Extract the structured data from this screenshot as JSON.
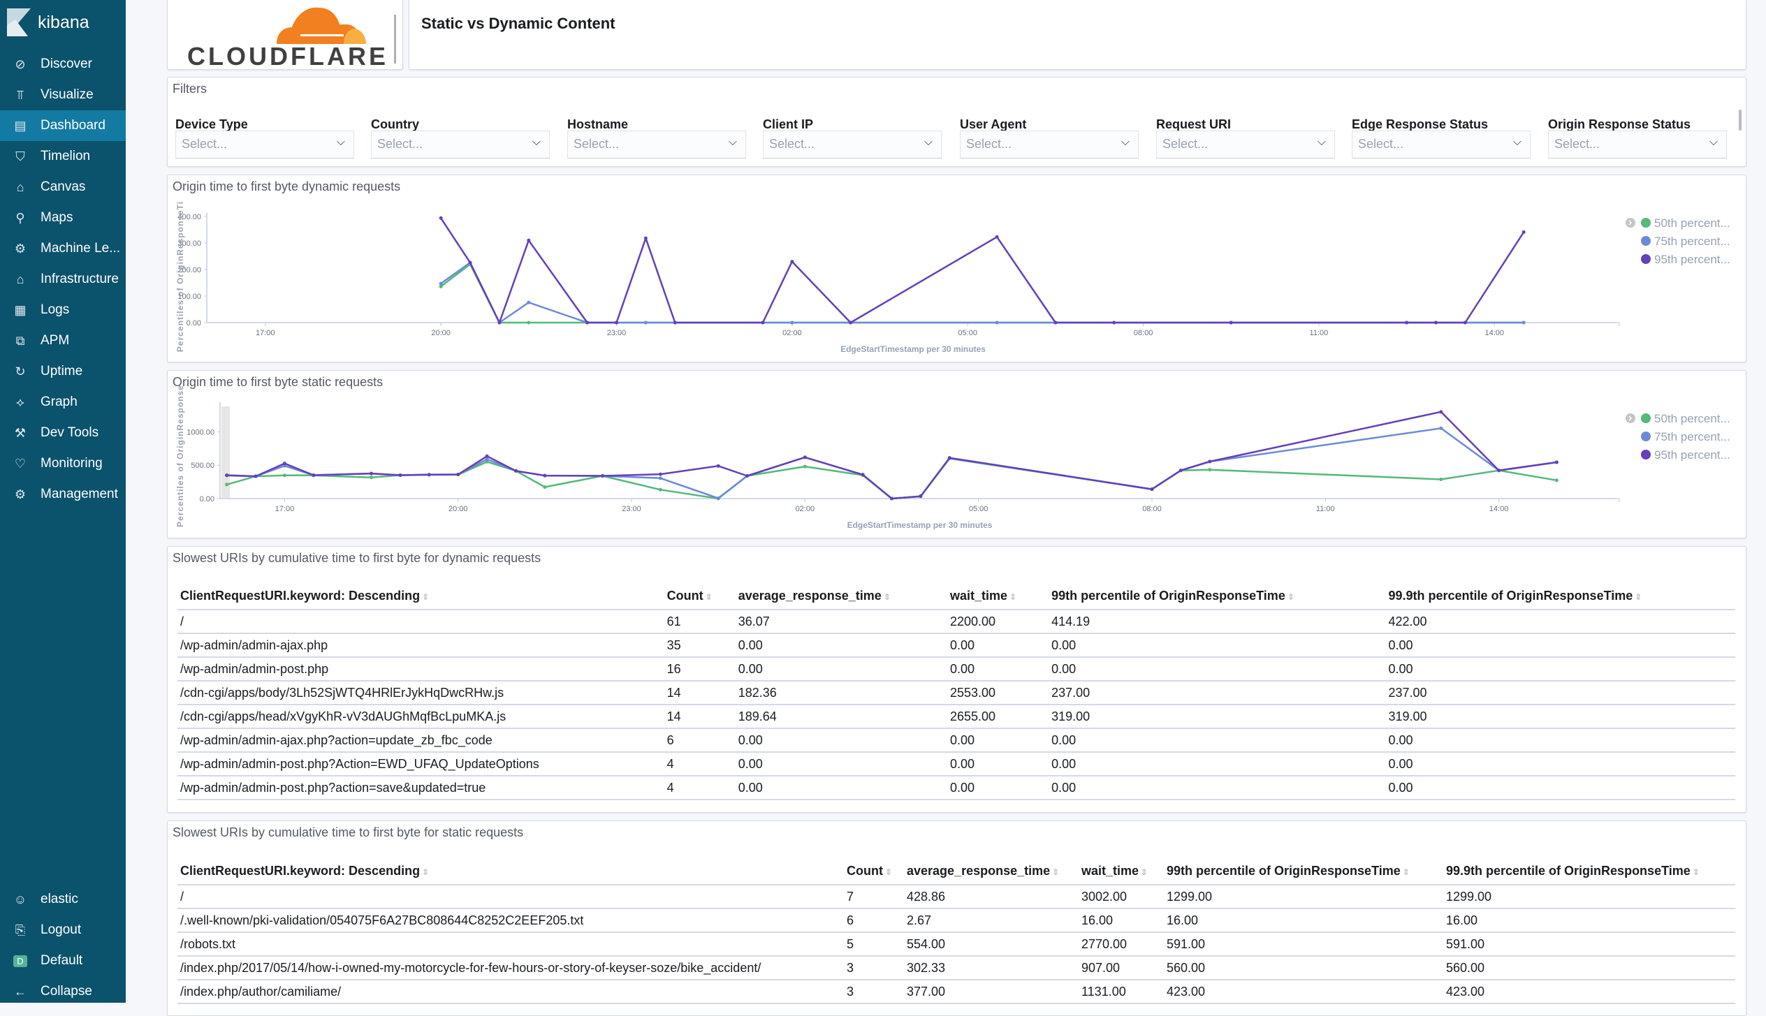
{
  "sidebar": {
    "brand": "kibana",
    "items": [
      {
        "label": "Discover",
        "icon": "compass-icon",
        "glyph": "⊘"
      },
      {
        "label": "Visualize",
        "icon": "chart-icon",
        "glyph": "⫪"
      },
      {
        "label": "Dashboard",
        "icon": "dashboard-icon",
        "glyph": "▤",
        "active": true
      },
      {
        "label": "Timelion",
        "icon": "timelion-icon",
        "glyph": "⛉"
      },
      {
        "label": "Canvas",
        "icon": "canvas-icon",
        "glyph": "⌂"
      },
      {
        "label": "Maps",
        "icon": "maps-icon",
        "glyph": "⚲"
      },
      {
        "label": "Machine Le...",
        "icon": "machine-learning-icon",
        "glyph": "⚙"
      },
      {
        "label": "Infrastructure",
        "icon": "infrastructure-icon",
        "glyph": "⌂"
      },
      {
        "label": "Logs",
        "icon": "logs-icon",
        "glyph": "▦"
      },
      {
        "label": "APM",
        "icon": "apm-icon",
        "glyph": "⧉"
      },
      {
        "label": "Uptime",
        "icon": "uptime-icon",
        "glyph": "↻"
      },
      {
        "label": "Graph",
        "icon": "graph-icon",
        "glyph": "⟡"
      },
      {
        "label": "Dev Tools",
        "icon": "wrench-icon",
        "glyph": "⚒"
      },
      {
        "label": "Monitoring",
        "icon": "monitoring-icon",
        "glyph": "♡"
      },
      {
        "label": "Management",
        "icon": "gear-icon",
        "glyph": "⚙"
      }
    ],
    "bottom": [
      {
        "label": "elastic",
        "icon": "user-icon",
        "glyph": "☺"
      },
      {
        "label": "Logout",
        "icon": "logout-icon",
        "glyph": "⎘"
      },
      {
        "label": "Default",
        "icon": "space-icon",
        "glyph": "D"
      },
      {
        "label": "Collapse",
        "icon": "arrow-left-icon",
        "glyph": "←"
      }
    ]
  },
  "logo": {
    "text": "CLOUDFLARE",
    "colors": {
      "orange": "#f38020",
      "light_orange": "#faae40",
      "text": "#404041"
    }
  },
  "markdown_title": "Static vs Dynamic Content",
  "filters": {
    "title": "Filters",
    "controls": [
      {
        "label": "Device Type",
        "placeholder": "Select..."
      },
      {
        "label": "Country",
        "placeholder": "Select..."
      },
      {
        "label": "Hostname",
        "placeholder": "Select..."
      },
      {
        "label": "Client IP",
        "placeholder": "Select..."
      },
      {
        "label": "User Agent",
        "placeholder": "Select..."
      },
      {
        "label": "Request URI",
        "placeholder": "Select..."
      },
      {
        "label": "Edge Response Status",
        "placeholder": "Select..."
      },
      {
        "label": "Origin Response Status",
        "placeholder": "Select..."
      }
    ]
  },
  "chart_data": [
    {
      "type": "line",
      "title": "Origin time to first byte dynamic requests",
      "xlabel": "EdgeStartTimestamp per 30 minutes",
      "ylabel": "Percentiles of OriginResponseTi",
      "xticks": [
        "17:00",
        "20:00",
        "23:00",
        "02:00",
        "05:00",
        "08:00",
        "11:00",
        "14:00"
      ],
      "xlim": [
        "16:00",
        "16:08"
      ],
      "yticks": [
        "0.00",
        "100.00",
        "200.00",
        "300.00",
        "400.00"
      ],
      "ylim": [
        0,
        400
      ],
      "legend": "top-right",
      "x": [
        "20:00",
        "20:30",
        "21:00",
        "21:30",
        "22:30",
        "23:00",
        "23:30",
        "00:00",
        "01:30",
        "02:00",
        "03:00",
        "05:30",
        "06:30",
        "07:30",
        "09:30",
        "12:30",
        "13:00",
        "13:30",
        "14:30"
      ],
      "series": [
        {
          "name": "50th percent...",
          "color": "#54b979",
          "values": [
            136,
            220,
            0,
            0,
            0,
            0,
            0,
            0,
            0,
            0,
            0,
            0,
            0,
            0,
            0,
            0,
            0,
            0,
            0
          ]
        },
        {
          "name": "75th percent...",
          "color": "#6c8ad8",
          "values": [
            147,
            226,
            0,
            76,
            0,
            0,
            0,
            0,
            0,
            0,
            0,
            0,
            0,
            0,
            0,
            0,
            0,
            0,
            0
          ]
        },
        {
          "name": "95th percent...",
          "color": "#6440b9",
          "values": [
            394,
            226,
            0,
            310,
            0,
            0,
            318,
            0,
            0,
            230,
            0,
            323,
            0,
            0,
            0,
            0,
            0,
            0,
            341
          ]
        }
      ]
    },
    {
      "type": "line",
      "title": "Origin time to first byte static requests",
      "xlabel": "EdgeStartTimestamp per 30 minutes",
      "ylabel": "Percentiles of OriginResponse",
      "xticks": [
        "17:00",
        "20:00",
        "23:00",
        "02:00",
        "05:00",
        "08:00",
        "11:00",
        "14:00"
      ],
      "xlim": [
        "15:53",
        "16:05"
      ],
      "yticks": [
        "0.00",
        "500.00",
        "1000.00"
      ],
      "ylim": [
        0,
        1380
      ],
      "legend": "top-right",
      "x": [
        "16:00",
        "16:30",
        "17:00",
        "17:30",
        "18:30",
        "19:00",
        "19:30",
        "20:00",
        "20:30",
        "21:00",
        "21:30",
        "22:30",
        "23:30",
        "00:30",
        "01:00",
        "02:00",
        "03:00",
        "03:30",
        "04:00",
        "04:30",
        "08:00",
        "08:30",
        "09:00",
        "13:00",
        "14:00",
        "15:00"
      ],
      "series": [
        {
          "name": "50th percent...",
          "color": "#54b979",
          "values": [
            210,
            333,
            347,
            347,
            316,
            350,
            355,
            358,
            551,
            415,
            172,
            340,
            133,
            0,
            340,
            480,
            350,
            0,
            35,
            600,
            140,
            421,
            432,
            288,
            421,
            274
          ]
        },
        {
          "name": "75th percent...",
          "color": "#6c8ad8",
          "values": [
            345,
            333,
            490,
            350,
            375,
            350,
            358,
            361,
            590,
            414,
            344,
            340,
            305,
            5,
            340,
            618,
            358,
            0,
            35,
            605,
            140,
            421,
            554,
            1053,
            421,
            544
          ]
        },
        {
          "name": "95th percent...",
          "color": "#6440b9",
          "values": [
            350,
            333,
            526,
            350,
            375,
            350,
            358,
            361,
            635,
            414,
            344,
            340,
            365,
            488,
            340,
            618,
            358,
            0,
            35,
            610,
            140,
            421,
            554,
            1298,
            421,
            544
          ]
        }
      ]
    }
  ],
  "dynamic_table": {
    "title": "Slowest URIs by cumulative time to first byte for dynamic requests",
    "columns": [
      "ClientRequestURI.keyword: Descending",
      "Count",
      "average_response_time",
      "wait_time",
      "99th percentile of OriginResponseTime",
      "99.9th percentile of OriginResponseTime"
    ],
    "rows": [
      [
        "/",
        "61",
        "36.07",
        "2200.00",
        "414.19",
        "422.00"
      ],
      [
        "/wp-admin/admin-ajax.php",
        "35",
        "0.00",
        "0.00",
        "0.00",
        "0.00"
      ],
      [
        "/wp-admin/admin-post.php",
        "16",
        "0.00",
        "0.00",
        "0.00",
        "0.00"
      ],
      [
        "/cdn-cgi/apps/body/3Lh52SjWTQ4HRlErJykHqDwcRHw.js",
        "14",
        "182.36",
        "2553.00",
        "237.00",
        "237.00"
      ],
      [
        "/cdn-cgi/apps/head/xVgyKhR-vV3dAUGhMqfBcLpuMKA.js",
        "14",
        "189.64",
        "2655.00",
        "319.00",
        "319.00"
      ],
      [
        "/wp-admin/admin-ajax.php?action=update_zb_fbc_code",
        "6",
        "0.00",
        "0.00",
        "0.00",
        "0.00"
      ],
      [
        "/wp-admin/admin-post.php?Action=EWD_UFAQ_UpdateOptions",
        "4",
        "0.00",
        "0.00",
        "0.00",
        "0.00"
      ],
      [
        "/wp-admin/admin-post.php?action=save&updated=true",
        "4",
        "0.00",
        "0.00",
        "0.00",
        "0.00"
      ]
    ]
  },
  "static_table": {
    "title": "Slowest URIs by cumulative time to first byte for static requests",
    "columns": [
      "ClientRequestURI.keyword: Descending",
      "Count",
      "average_response_time",
      "wait_time",
      "99th percentile of OriginResponseTime",
      "99.9th percentile of OriginResponseTime"
    ],
    "rows": [
      [
        "/",
        "7",
        "428.86",
        "3002.00",
        "1299.00",
        "1299.00"
      ],
      [
        "/.well-known/pki-validation/054075F6A27BC808644C8252C2EEF205.txt",
        "6",
        "2.67",
        "16.00",
        "16.00",
        "16.00"
      ],
      [
        "/robots.txt",
        "5",
        "554.00",
        "2770.00",
        "591.00",
        "591.00"
      ],
      [
        "/index.php/2017/05/14/how-i-owned-my-motorcycle-for-few-hours-or-story-of-keyser-soze/bike_accident/",
        "3",
        "302.33",
        "907.00",
        "560.00",
        "560.00"
      ],
      [
        "/index.php/author/camiliame/",
        "3",
        "377.00",
        "1131.00",
        "423.00",
        "423.00"
      ]
    ]
  }
}
